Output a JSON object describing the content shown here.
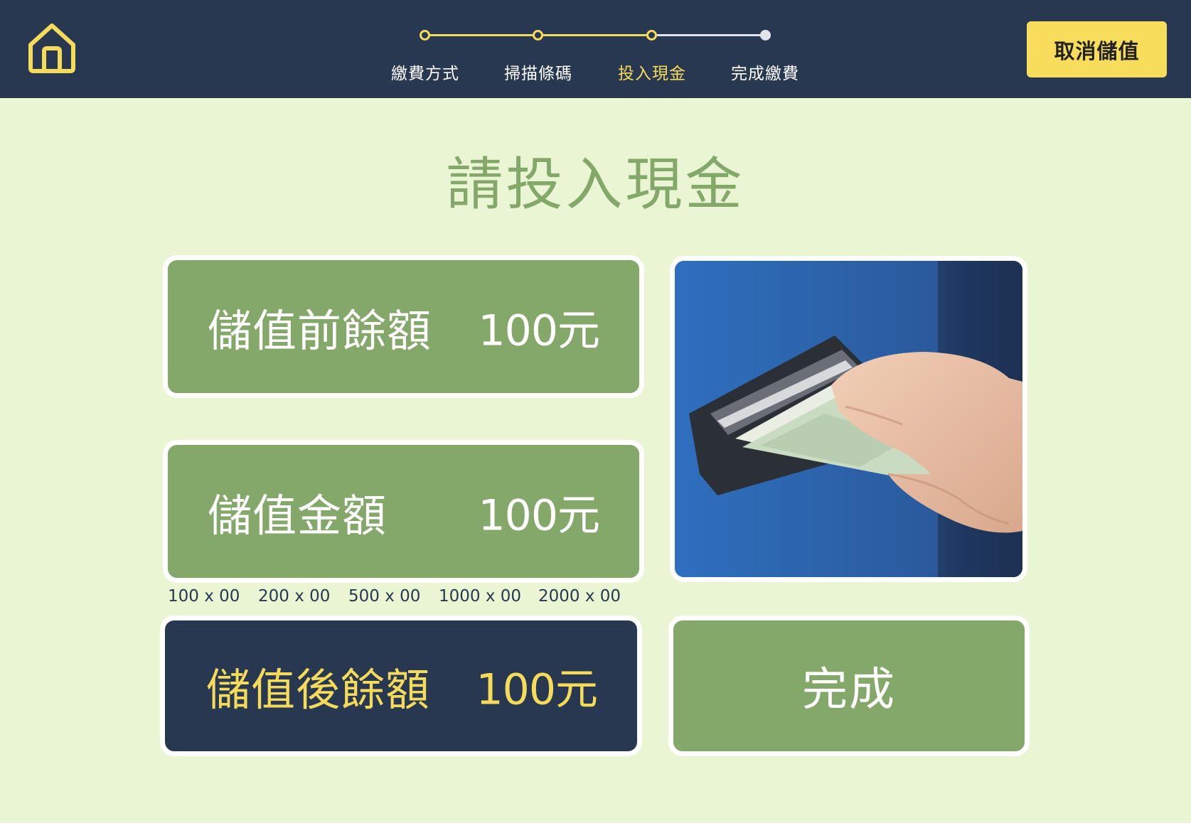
{
  "header": {
    "home_icon": "home-icon",
    "steps": [
      {
        "label": "繳費方式",
        "state": "done"
      },
      {
        "label": "掃描條碼",
        "state": "done"
      },
      {
        "label": "投入現金",
        "state": "active"
      },
      {
        "label": "完成繳費",
        "state": "todo"
      }
    ],
    "cancel_label": "取消儲值"
  },
  "main": {
    "title": "請投入現金",
    "balance_before": {
      "label": "儲值前餘額",
      "value": "100元"
    },
    "topup_amount": {
      "label": "儲值金額",
      "value": "100元"
    },
    "denominations": [
      "100 x 00",
      "200 x 00",
      "500 x 00",
      "1000 x 00",
      "2000 x 00"
    ],
    "balance_after": {
      "label": "儲值後餘額",
      "value": "100元"
    },
    "done_label": "完成"
  },
  "colors": {
    "header_bg": "#283850",
    "accent_yellow": "#f6db5b",
    "page_bg": "#e9f5d3",
    "card_green": "#84a76a",
    "card_dark": "#283850"
  }
}
